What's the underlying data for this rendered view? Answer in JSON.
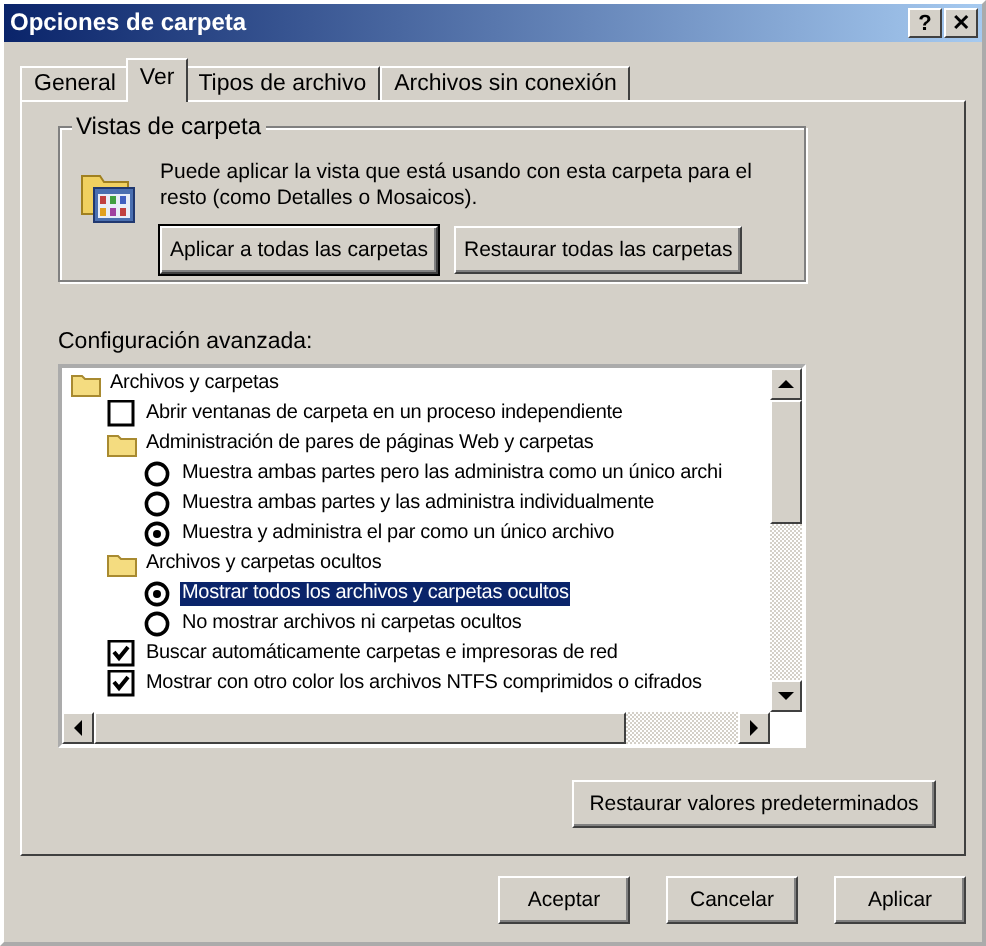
{
  "window": {
    "title": "Opciones de carpeta",
    "buttons": [
      {
        "label": "?"
      },
      {
        "label": "✕"
      }
    ]
  },
  "tabs": [
    {
      "label": "General",
      "selected": false
    },
    {
      "label": "Ver",
      "selected": true
    },
    {
      "label": "Tipos de archivo",
      "selected": false
    },
    {
      "label": "Archivos sin conexión",
      "selected": false
    }
  ],
  "folder_views": {
    "title": "Vistas de carpeta",
    "text": "Puede aplicar la vista que está usando con esta carpeta para el resto (como Detalles o Mosaicos).",
    "buttons": [
      {
        "label": "Aplicar a todas las carpetas",
        "focused": true
      },
      {
        "label": "Restaurar todas las carpetas",
        "focused": false
      }
    ]
  },
  "advanced": {
    "label": "Configuración avanzada:",
    "items": [
      {
        "kind": "folder",
        "label": "Archivos y carpetas",
        "selected": false,
        "children": [
          {
            "kind": "checkbox",
            "label": "Abrir ventanas de carpeta  en un proceso independiente",
            "checked": false,
            "selected": false
          },
          {
            "kind": "folder",
            "label": "Administración de pares de páginas Web y carpetas",
            "selected": false,
            "children": [
              {
                "kind": "radio",
                "label": "Muestra ambas partes pero las administra como un único archi",
                "checked": false,
                "selected": false
              },
              {
                "kind": "radio",
                "label": "Muestra ambas partes y las administra individualmente",
                "checked": false,
                "selected": false
              },
              {
                "kind": "radio",
                "label": "Muestra y administra el par como un único archivo",
                "checked": true,
                "selected": false
              }
            ]
          },
          {
            "kind": "folder",
            "label": "Archivos y carpetas ocultos",
            "selected": false,
            "children": [
              {
                "kind": "radio",
                "label": "Mostrar todos los archivos y carpetas ocultos",
                "checked": true,
                "selected": true
              },
              {
                "kind": "radio",
                "label": "No mostrar archivos ni carpetas ocultos",
                "checked": false,
                "selected": false
              }
            ]
          },
          {
            "kind": "checkbox",
            "label": "Buscar automáticamente carpetas e impresoras de red",
            "checked": true,
            "selected": false
          },
          {
            "kind": "checkbox",
            "label": "Mostrar con otro color los archivos NTFS comprimidos o cifrados",
            "checked": true,
            "selected": false
          }
        ]
      }
    ],
    "restore_button": "Restaurar valores predeterminados"
  },
  "buttons": [
    {
      "label": "Aceptar"
    },
    {
      "label": "Cancelar"
    },
    {
      "label": "Aplicar"
    }
  ]
}
